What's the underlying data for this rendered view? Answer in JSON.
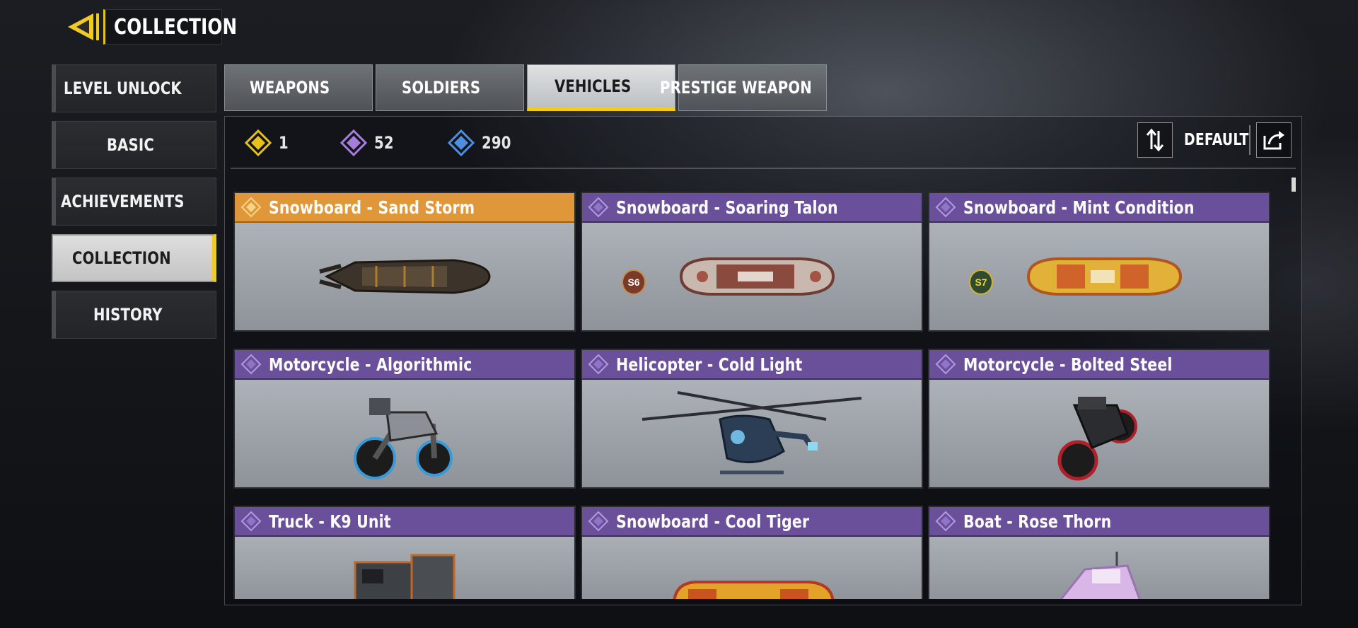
{
  "header": {
    "title": "COLLECTION"
  },
  "sidebar": {
    "items": [
      {
        "label": "LEVEL UNLOCK"
      },
      {
        "label": "BASIC"
      },
      {
        "label": "ACHIEVEMENTS"
      },
      {
        "label": "COLLECTION",
        "active": true
      },
      {
        "label": "HISTORY"
      }
    ]
  },
  "tabs": [
    {
      "label": "WEAPONS"
    },
    {
      "label": "SOLDIERS"
    },
    {
      "label": "VEHICLES",
      "active": true
    },
    {
      "label": "PRESTIGE WEAPON"
    }
  ],
  "currencies": [
    {
      "value": "1",
      "icon": "legendary-diamond-icon",
      "color": "#e8c21c"
    },
    {
      "value": "52",
      "icon": "epic-diamond-icon",
      "color": "#a77ddb"
    },
    {
      "value": "290",
      "icon": "rare-diamond-icon",
      "color": "#4c8fe0"
    }
  ],
  "sort": {
    "label": "DEFAULT"
  },
  "rarity_colors": {
    "legendary": "#e0973a",
    "epic": "#6a4f9a"
  },
  "cards": [
    {
      "name": "Snowboard - Sand Storm",
      "rarity": "legendary",
      "vehicle": "snowboard"
    },
    {
      "name": "Snowboard - Soaring Talon",
      "rarity": "epic",
      "vehicle": "snowboard",
      "season": "S6"
    },
    {
      "name": "Snowboard - Mint Condition",
      "rarity": "epic",
      "vehicle": "snowboard",
      "season": "S7"
    },
    {
      "name": "Motorcycle - Algorithmic",
      "rarity": "epic",
      "vehicle": "motorcycle"
    },
    {
      "name": "Helicopter - Cold Light",
      "rarity": "epic",
      "vehicle": "helicopter"
    },
    {
      "name": "Motorcycle - Bolted Steel",
      "rarity": "epic",
      "vehicle": "motorcycle"
    },
    {
      "name": "Truck - K9 Unit",
      "rarity": "epic",
      "vehicle": "truck"
    },
    {
      "name": "Snowboard - Cool Tiger",
      "rarity": "epic",
      "vehicle": "snowboard"
    },
    {
      "name": "Boat - Rose Thorn",
      "rarity": "epic",
      "vehicle": "boat"
    }
  ]
}
